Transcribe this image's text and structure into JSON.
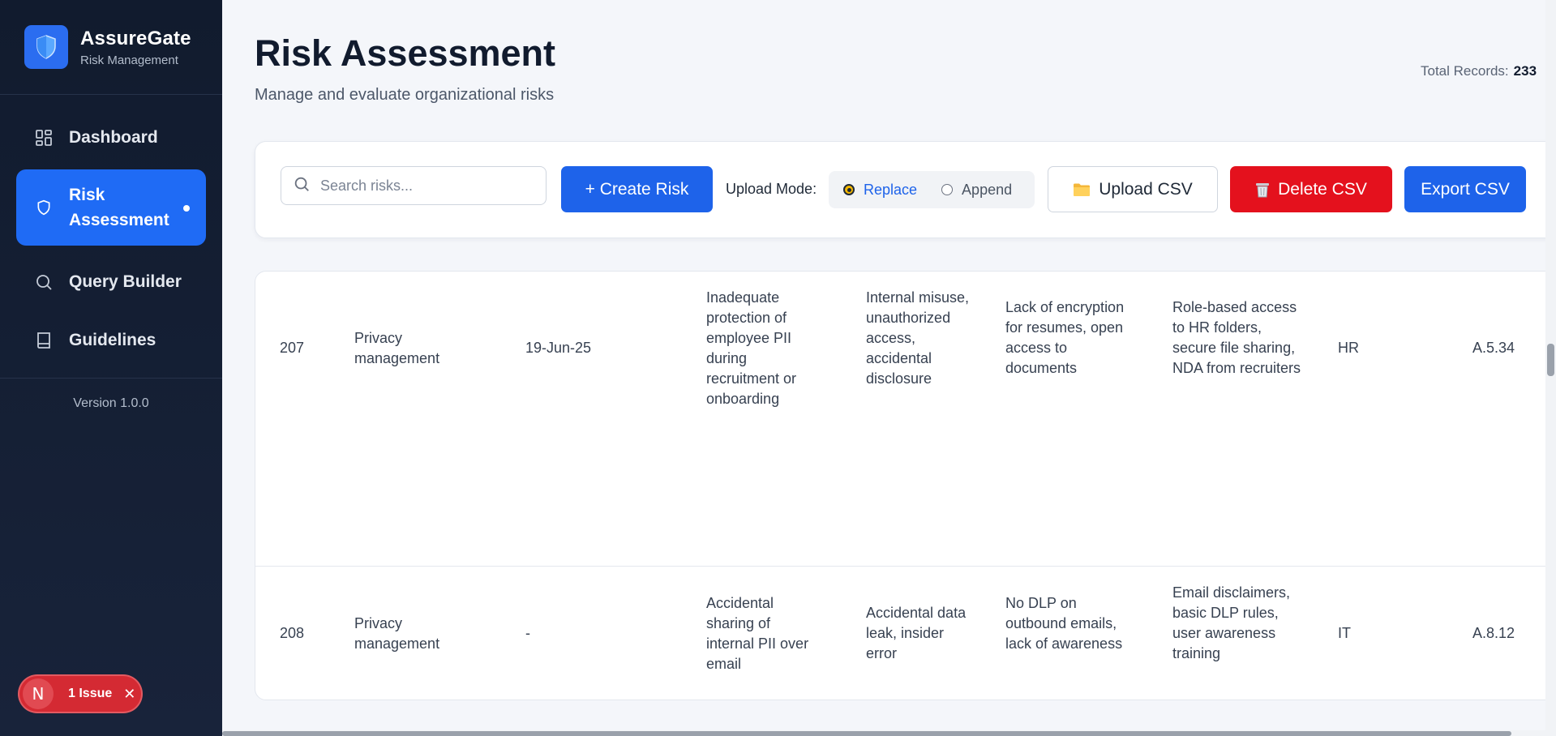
{
  "app": {
    "name": "AssureGate",
    "subtitle": "Risk Management",
    "version": "Version 1.0.0"
  },
  "nav": [
    {
      "label": "Dashboard",
      "icon": "grid-icon"
    },
    {
      "label": "Risk Assessment",
      "icon": "shield-icon",
      "active": true
    },
    {
      "label": "Query Builder",
      "icon": "search-icon"
    },
    {
      "label": "Guidelines",
      "icon": "book-icon"
    }
  ],
  "issue": {
    "initial": "N",
    "label": "1 Issue"
  },
  "page": {
    "title": "Risk Assessment",
    "subtitle": "Manage and evaluate organizational risks",
    "total_label": "Total Records:",
    "total_value": "233"
  },
  "toolbar": {
    "search_placeholder": "Search risks...",
    "create_label": "+ Create Risk",
    "upload_mode_label": "Upload Mode:",
    "mode_replace": "Replace",
    "mode_append": "Append",
    "selected_mode": "Replace",
    "upload_label": "Upload CSV",
    "delete_label": "Delete CSV",
    "export_label": "Export CSV"
  },
  "rows": [
    {
      "id": "207",
      "category": "Privacy management",
      "date": "19-Jun-25",
      "risk": "Inadequate protection of employee PII during recruitment or onboarding",
      "threat": "Internal misuse, unauthorized access, accidental disclosure",
      "vulnerability": "Lack of encryption for resumes, open access to documents",
      "controls": "Role-based access to HR folders, secure file sharing, NDA from recruiters",
      "owner": "HR",
      "ref": "A.5.34"
    },
    {
      "id": "208",
      "category": "Privacy management",
      "date": "-",
      "risk": "Accidental sharing of internal PII over email",
      "threat": "Accidental data leak, insider error",
      "vulnerability": "No DLP on outbound emails, lack of awareness",
      "controls": "Email disclaimers, basic DLP rules, user awareness training",
      "owner": "IT",
      "ref": "A.8.12"
    }
  ],
  "colors": {
    "primary": "#1e63ea",
    "danger": "#e4111d",
    "sidebar": "#111b2e"
  }
}
